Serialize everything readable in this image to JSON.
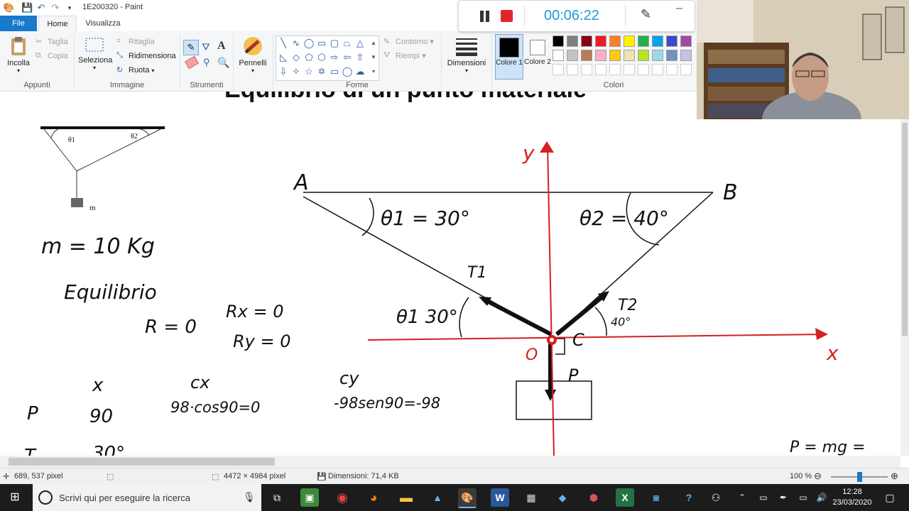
{
  "window": {
    "title": "1E200320 - Paint"
  },
  "tabs": {
    "file": "File",
    "home": "Home",
    "view": "Visualizza"
  },
  "ribbon": {
    "clipboard": {
      "paste": "Incolla",
      "cut": "Taglia",
      "copy": "Copia",
      "group": "Appunti"
    },
    "image": {
      "select": "Seleziona",
      "crop": "Ritaglia",
      "resize": "Ridimensiona",
      "rotate": "Ruota",
      "group": "Immagine"
    },
    "tools": {
      "group": "Strumenti"
    },
    "brushes": {
      "label": "Pennelli"
    },
    "shapes": {
      "outline": "Contorno",
      "fill": "Riempi",
      "group": "Forme"
    },
    "size": {
      "label": "Dimensioni"
    },
    "colors": {
      "color1": "Colore 1",
      "color2": "Colore 2",
      "group": "Colori",
      "palette_row1": [
        "#000000",
        "#7f7f7f",
        "#880015",
        "#ed1c24",
        "#ff7f27",
        "#fff200",
        "#22b14c",
        "#00a2e8",
        "#3f48cc",
        "#a349a4"
      ],
      "palette_row2": [
        "#ffffff",
        "#c3c3c3",
        "#b97a57",
        "#ffaec9",
        "#ffc90e",
        "#efe4b0",
        "#b5e61d",
        "#99d9ea",
        "#7092be",
        "#c8bfe7"
      ]
    }
  },
  "recorder": {
    "timer": "00:06:22"
  },
  "canvas": {
    "heading_partial": "Equilibrio di un punto materiale",
    "fig_theta1": "θ1",
    "fig_theta2": "θ2",
    "fig_m": "m",
    "mass": "m = 10 Kg",
    "equilibrio": "Equilibrio",
    "r_vector": "R = 0",
    "rx": "Rx = 0",
    "ry": "Ry = 0",
    "col_x": "x",
    "col_cx": "cx",
    "col_cy": "cy",
    "row_p": "P",
    "row_p_x": "90",
    "row_p_cx": "98·cos90=0",
    "row_p_cy": "-98sen90=-98",
    "row_t_partial": "T",
    "row_t_x_partial": "30°",
    "label_a": "A",
    "label_b": "B",
    "theta1_eq": "θ1 = 30°",
    "theta2_eq": "θ2 = 40°",
    "label_t1": "T1",
    "label_t2": "T2",
    "theta1_30": "θ1 30°",
    "angle_40": "40°",
    "label_o": "O",
    "label_c": "C",
    "label_p": "P",
    "axis_y": "y",
    "axis_x": "x",
    "p_mg": "P = mg ="
  },
  "status": {
    "cursor": "689, 537 pixel",
    "dimensions": "4472 × 4984 pixel",
    "filesize": "Dimensioni: 71,4 KB",
    "zoom": "100 %",
    "zoom_level": 0.5
  },
  "taskbar": {
    "search_placeholder": "Scrivi qui per eseguire la ricerca",
    "time": "12:28",
    "date": "23/03/2020"
  }
}
